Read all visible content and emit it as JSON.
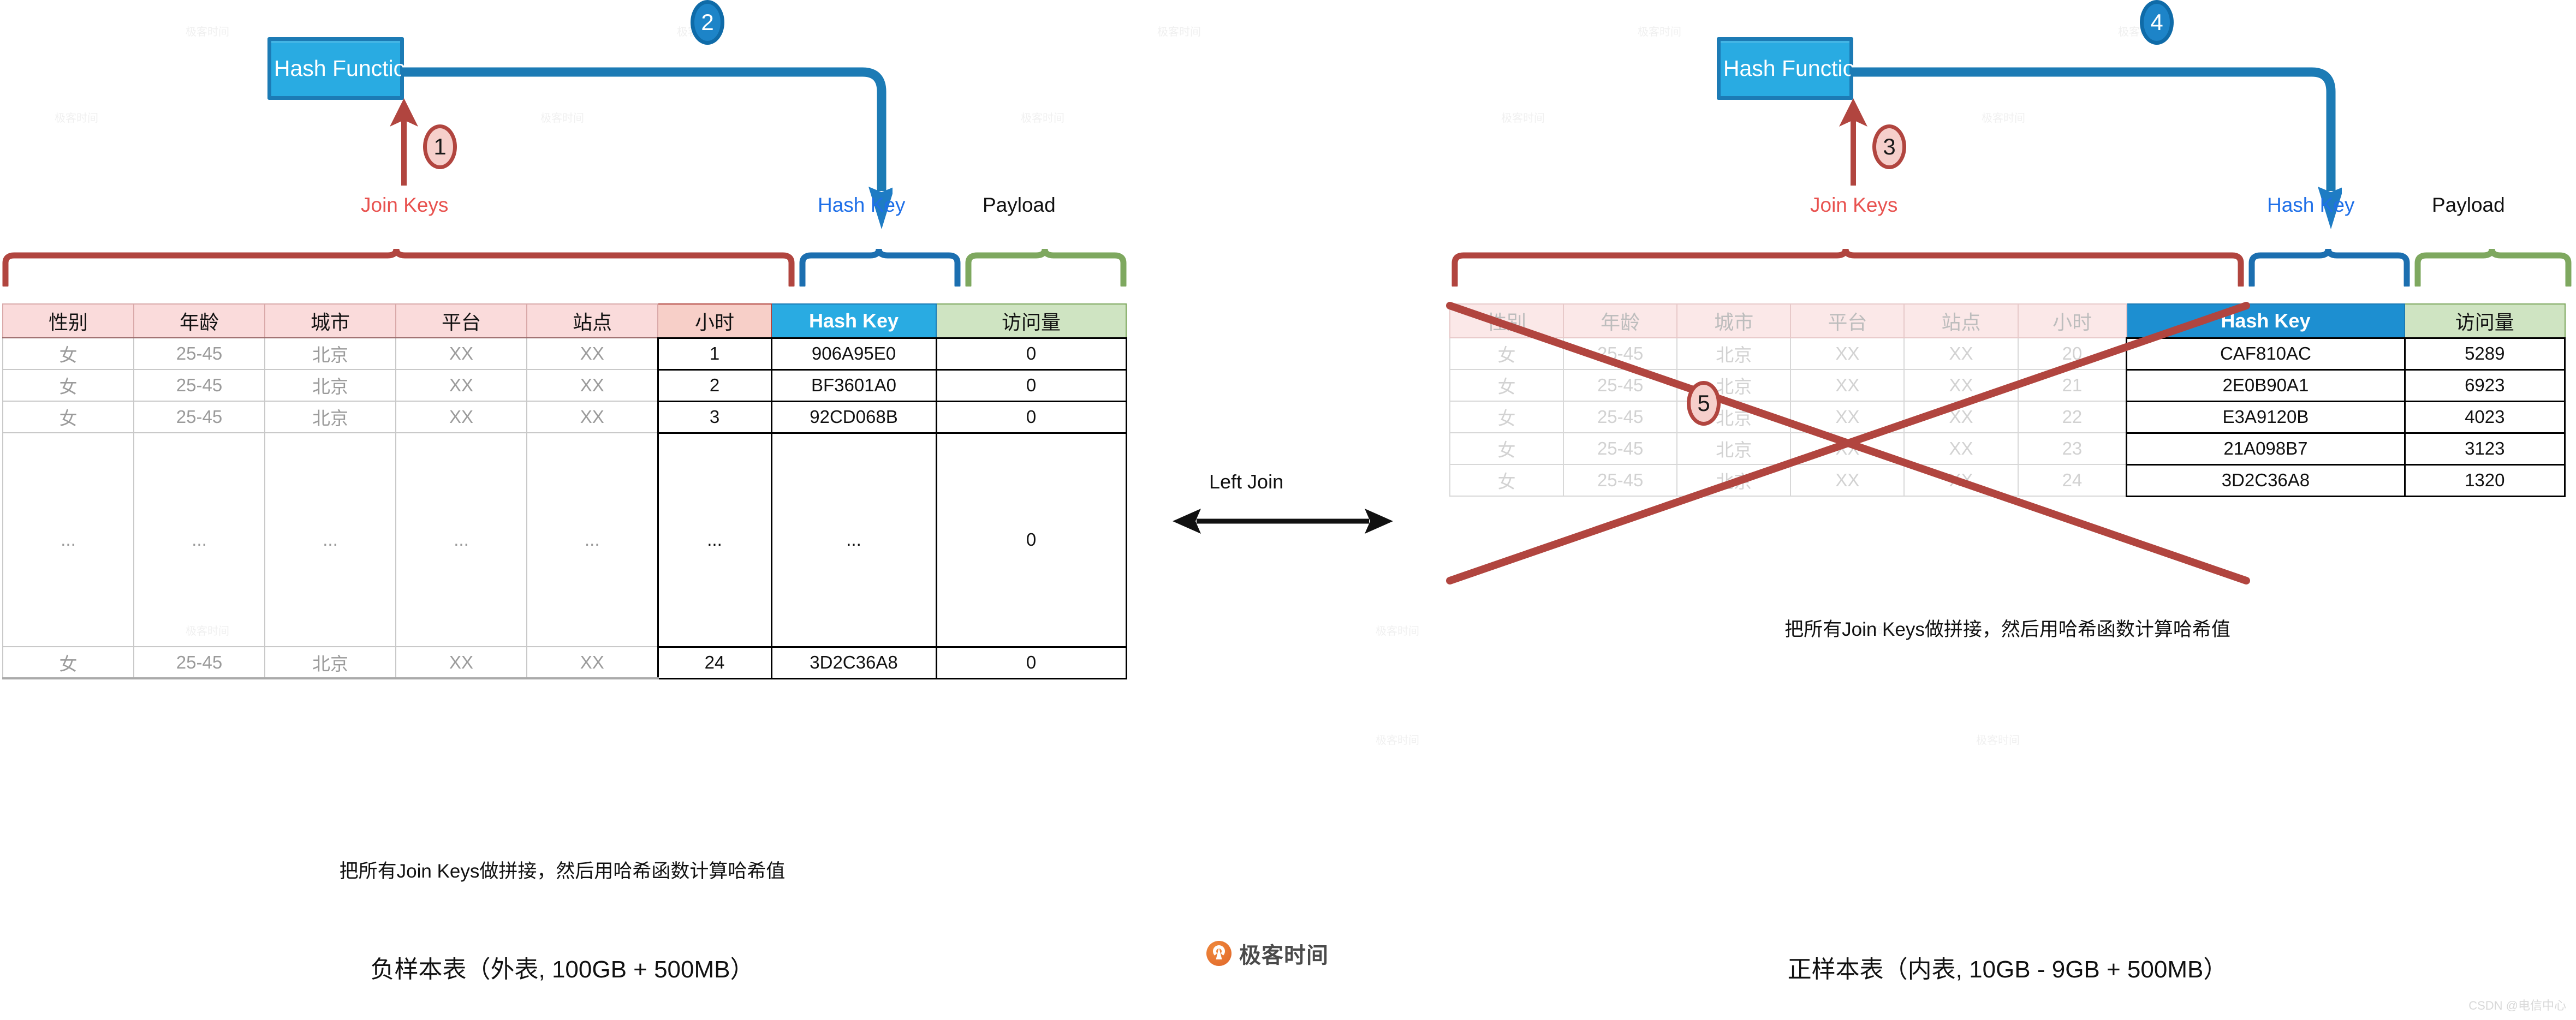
{
  "meta": {
    "csdn_watermark": "CSDN @电信中心",
    "logo_text": "极客时间"
  },
  "center": {
    "left_join_label": "Left Join"
  },
  "left_panel": {
    "hash_function_label": "Hash Function",
    "hash_glyph": "#",
    "badge_in": "1",
    "badge_out": "2",
    "brace_labels": {
      "join_keys": "Join Keys",
      "hash_key": "Hash Key",
      "payload": "Payload"
    },
    "caption_note": "把所有Join Keys做拼接，然后用哈希函数计算哈希值",
    "caption_title": "负样本表（外表, 100GB + 500MB）",
    "table": {
      "headers": [
        "性别",
        "年龄",
        "城市",
        "平台",
        "站点",
        "小时",
        "Hash Key",
        "访问量"
      ],
      "rows": [
        {
          "cells": [
            "女",
            "25-45",
            "北京",
            "XX",
            "XX",
            "1",
            "906A95E0",
            "0"
          ],
          "ellipsis": false
        },
        {
          "cells": [
            "女",
            "25-45",
            "北京",
            "XX",
            "XX",
            "2",
            "BF3601A0",
            "0"
          ],
          "ellipsis": false
        },
        {
          "cells": [
            "女",
            "25-45",
            "北京",
            "XX",
            "XX",
            "3",
            "92CD068B",
            "0"
          ],
          "ellipsis": false
        },
        {
          "cells": [
            "...",
            "...",
            "...",
            "...",
            "...",
            "...",
            "...",
            "0"
          ],
          "ellipsis": true
        },
        {
          "cells": [
            "女",
            "25-45",
            "北京",
            "XX",
            "XX",
            "24",
            "3D2C36A8",
            "0"
          ],
          "ellipsis": false
        }
      ]
    }
  },
  "right_panel": {
    "hash_function_label": "Hash Function",
    "hash_glyph": "#",
    "badge_in": "3",
    "badge_out": "4",
    "badge_cross": "5",
    "brace_labels": {
      "join_keys": "Join Keys",
      "hash_key": "Hash Key",
      "payload": "Payload"
    },
    "caption_note": "把所有Join Keys做拼接，然后用哈希函数计算哈希值",
    "caption_title": "正样本表（内表, 10GB - 9GB + 500MB）",
    "table": {
      "headers": [
        "性别",
        "年龄",
        "城市",
        "平台",
        "站点",
        "小时",
        "Hash Key",
        "访问量"
      ],
      "rows": [
        {
          "cells": [
            "女",
            "25-45",
            "北京",
            "XX",
            "XX",
            "20",
            "CAF810AC",
            "5289"
          ]
        },
        {
          "cells": [
            "女",
            "25-45",
            "北京",
            "XX",
            "XX",
            "21",
            "2E0B90A1",
            "6923"
          ]
        },
        {
          "cells": [
            "女",
            "25-45",
            "北京",
            "XX",
            "XX",
            "22",
            "E3A9120B",
            "4023"
          ]
        },
        {
          "cells": [
            "女",
            "25-45",
            "北京",
            "XX",
            "XX",
            "23",
            "21A098B7",
            "3123"
          ]
        },
        {
          "cells": [
            "女",
            "25-45",
            "北京",
            "XX",
            "XX",
            "24",
            "3D2C36A8",
            "1320"
          ]
        }
      ]
    }
  },
  "colors": {
    "hash_blue": "#29ABE2",
    "hash_blue_dark": "#1C7BB5",
    "join_red": "#B1453F",
    "join_text_red": "#E8524F",
    "hash_key_blue": "#1E6FE8",
    "payload_green": "#7EA85F",
    "header_pink": "#FADBDB",
    "header_green": "#CFE4C2",
    "cross_red": "#B1453F",
    "logo_orange": "#E0662A"
  }
}
